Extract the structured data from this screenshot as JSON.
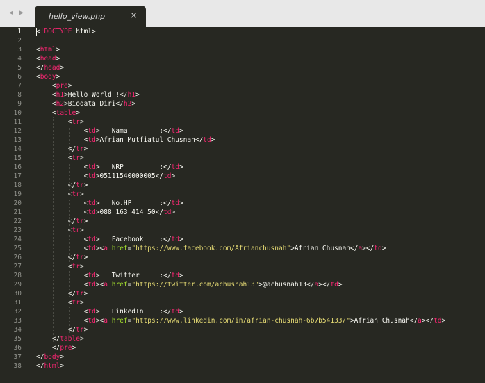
{
  "tab": {
    "title": "hello_view.php",
    "close": "×"
  },
  "nav": {
    "back": "◀",
    "forward": "▶"
  },
  "lines": [
    {
      "n": "1",
      "tokens": [
        [
          "t",
          "<"
        ],
        [
          "k",
          "!DOCTYPE"
        ],
        [
          "t",
          " html>"
        ]
      ]
    },
    {
      "n": "2",
      "tokens": []
    },
    {
      "n": "3",
      "tokens": [
        [
          "t",
          "<"
        ],
        [
          "k",
          "html"
        ],
        [
          "t",
          ">"
        ]
      ]
    },
    {
      "n": "4",
      "tokens": [
        [
          "t",
          "<"
        ],
        [
          "k",
          "head"
        ],
        [
          "t",
          ">"
        ]
      ]
    },
    {
      "n": "5",
      "tokens": [
        [
          "t",
          "</"
        ],
        [
          "k",
          "head"
        ],
        [
          "t",
          ">"
        ]
      ]
    },
    {
      "n": "6",
      "tokens": [
        [
          "t",
          "<"
        ],
        [
          "k",
          "body"
        ],
        [
          "t",
          ">"
        ]
      ]
    },
    {
      "n": "7",
      "tokens": [
        [
          "t",
          "    <"
        ],
        [
          "k",
          "pre"
        ],
        [
          "t",
          ">"
        ]
      ]
    },
    {
      "n": "8",
      "tokens": [
        [
          "t",
          "    <"
        ],
        [
          "k",
          "h1"
        ],
        [
          "t",
          ">Hello World !</"
        ],
        [
          "k",
          "h1"
        ],
        [
          "t",
          ">"
        ]
      ]
    },
    {
      "n": "9",
      "tokens": [
        [
          "t",
          "    <"
        ],
        [
          "k",
          "h2"
        ],
        [
          "t",
          ">Biodata Diri</"
        ],
        [
          "k",
          "h2"
        ],
        [
          "t",
          ">"
        ]
      ]
    },
    {
      "n": "10",
      "tokens": [
        [
          "t",
          "    <"
        ],
        [
          "k",
          "table"
        ],
        [
          "t",
          ">"
        ]
      ]
    },
    {
      "n": "11",
      "tokens": [
        [
          "t",
          "        <"
        ],
        [
          "k",
          "tr"
        ],
        [
          "t",
          ">"
        ]
      ]
    },
    {
      "n": "12",
      "tokens": [
        [
          "t",
          "            <"
        ],
        [
          "k",
          "td"
        ],
        [
          "t",
          ">   Nama        :</"
        ],
        [
          "k",
          "td"
        ],
        [
          "t",
          ">"
        ]
      ]
    },
    {
      "n": "13",
      "tokens": [
        [
          "t",
          "            <"
        ],
        [
          "k",
          "td"
        ],
        [
          "t",
          ">Afrian Mutfiatul Chusnah</"
        ],
        [
          "k",
          "td"
        ],
        [
          "t",
          ">"
        ]
      ]
    },
    {
      "n": "14",
      "tokens": [
        [
          "t",
          "        </"
        ],
        [
          "k",
          "tr"
        ],
        [
          "t",
          ">"
        ]
      ]
    },
    {
      "n": "15",
      "tokens": [
        [
          "t",
          "        <"
        ],
        [
          "k",
          "tr"
        ],
        [
          "t",
          ">"
        ]
      ]
    },
    {
      "n": "16",
      "tokens": [
        [
          "t",
          "            <"
        ],
        [
          "k",
          "td"
        ],
        [
          "t",
          ">   NRP         :</"
        ],
        [
          "k",
          "td"
        ],
        [
          "t",
          ">"
        ]
      ]
    },
    {
      "n": "17",
      "tokens": [
        [
          "t",
          "            <"
        ],
        [
          "k",
          "td"
        ],
        [
          "t",
          ">05111540000005</"
        ],
        [
          "k",
          "td"
        ],
        [
          "t",
          ">"
        ]
      ]
    },
    {
      "n": "18",
      "tokens": [
        [
          "t",
          "        </"
        ],
        [
          "k",
          "tr"
        ],
        [
          "t",
          ">"
        ]
      ]
    },
    {
      "n": "19",
      "tokens": [
        [
          "t",
          "        <"
        ],
        [
          "k",
          "tr"
        ],
        [
          "t",
          ">"
        ]
      ]
    },
    {
      "n": "20",
      "tokens": [
        [
          "t",
          "            <"
        ],
        [
          "k",
          "td"
        ],
        [
          "t",
          ">   No.HP       :</"
        ],
        [
          "k",
          "td"
        ],
        [
          "t",
          ">"
        ]
      ]
    },
    {
      "n": "21",
      "tokens": [
        [
          "t",
          "            <"
        ],
        [
          "k",
          "td"
        ],
        [
          "t",
          ">088 163 414 50</"
        ],
        [
          "k",
          "td"
        ],
        [
          "t",
          ">"
        ]
      ]
    },
    {
      "n": "22",
      "tokens": [
        [
          "t",
          "        </"
        ],
        [
          "k",
          "tr"
        ],
        [
          "t",
          ">"
        ]
      ]
    },
    {
      "n": "23",
      "tokens": [
        [
          "t",
          "        <"
        ],
        [
          "k",
          "tr"
        ],
        [
          "t",
          ">"
        ]
      ]
    },
    {
      "n": "24",
      "tokens": [
        [
          "t",
          "            <"
        ],
        [
          "k",
          "td"
        ],
        [
          "t",
          ">   Facebook    :</"
        ],
        [
          "k",
          "td"
        ],
        [
          "t",
          ">"
        ]
      ]
    },
    {
      "n": "25",
      "tokens": [
        [
          "t",
          "            <"
        ],
        [
          "k",
          "td"
        ],
        [
          "t",
          "><"
        ],
        [
          "k",
          "a"
        ],
        [
          "t",
          " "
        ],
        [
          "a",
          "href"
        ],
        [
          "t",
          "="
        ],
        [
          "s",
          "\"https://www.facebook.com/Afrianchusnah\""
        ],
        [
          "t",
          ">Afrian Chusnah</"
        ],
        [
          "k",
          "a"
        ],
        [
          "t",
          "></"
        ],
        [
          "k",
          "td"
        ],
        [
          "t",
          ">"
        ]
      ]
    },
    {
      "n": "26",
      "tokens": [
        [
          "t",
          "        </"
        ],
        [
          "k",
          "tr"
        ],
        [
          "t",
          ">"
        ]
      ]
    },
    {
      "n": "27",
      "tokens": [
        [
          "t",
          "        <"
        ],
        [
          "k",
          "tr"
        ],
        [
          "t",
          ">"
        ]
      ]
    },
    {
      "n": "28",
      "tokens": [
        [
          "t",
          "            <"
        ],
        [
          "k",
          "td"
        ],
        [
          "t",
          ">   Twitter     :</"
        ],
        [
          "k",
          "td"
        ],
        [
          "t",
          ">"
        ]
      ]
    },
    {
      "n": "29",
      "tokens": [
        [
          "t",
          "            <"
        ],
        [
          "k",
          "td"
        ],
        [
          "t",
          "><"
        ],
        [
          "k",
          "a"
        ],
        [
          "t",
          " "
        ],
        [
          "a",
          "href"
        ],
        [
          "t",
          "="
        ],
        [
          "s",
          "\"https://twitter.com/achusnah13\""
        ],
        [
          "t",
          ">@achusnah13</"
        ],
        [
          "k",
          "a"
        ],
        [
          "t",
          "></"
        ],
        [
          "k",
          "td"
        ],
        [
          "t",
          ">"
        ]
      ]
    },
    {
      "n": "30",
      "tokens": [
        [
          "t",
          "        </"
        ],
        [
          "k",
          "tr"
        ],
        [
          "t",
          ">"
        ]
      ]
    },
    {
      "n": "31",
      "tokens": [
        [
          "t",
          "        <"
        ],
        [
          "k",
          "tr"
        ],
        [
          "t",
          ">"
        ]
      ]
    },
    {
      "n": "32",
      "tokens": [
        [
          "t",
          "            <"
        ],
        [
          "k",
          "td"
        ],
        [
          "t",
          ">   LinkedIn    :</"
        ],
        [
          "k",
          "td"
        ],
        [
          "t",
          ">"
        ]
      ]
    },
    {
      "n": "33",
      "tokens": [
        [
          "t",
          "            <"
        ],
        [
          "k",
          "td"
        ],
        [
          "t",
          "><"
        ],
        [
          "k",
          "a"
        ],
        [
          "t",
          " "
        ],
        [
          "a",
          "href"
        ],
        [
          "t",
          "="
        ],
        [
          "s",
          "\"https://www.linkedin.com/in/afrian-chusnah-6b7b54133/\""
        ],
        [
          "t",
          ">Afrian Chusnah</"
        ],
        [
          "k",
          "a"
        ],
        [
          "t",
          "></"
        ],
        [
          "k",
          "td"
        ],
        [
          "t",
          ">"
        ]
      ]
    },
    {
      "n": "34",
      "tokens": [
        [
          "t",
          "        </"
        ],
        [
          "k",
          "tr"
        ],
        [
          "t",
          ">"
        ]
      ]
    },
    {
      "n": "35",
      "tokens": [
        [
          "t",
          "    </"
        ],
        [
          "k",
          "table"
        ],
        [
          "t",
          ">"
        ]
      ]
    },
    {
      "n": "36",
      "tokens": [
        [
          "t",
          "    </"
        ],
        [
          "k",
          "pre"
        ],
        [
          "t",
          ">"
        ]
      ]
    },
    {
      "n": "37",
      "tokens": [
        [
          "t",
          "</"
        ],
        [
          "k",
          "body"
        ],
        [
          "t",
          ">"
        ]
      ]
    },
    {
      "n": "38",
      "tokens": [
        [
          "t",
          "</"
        ],
        [
          "k",
          "html"
        ],
        [
          "t",
          ">"
        ]
      ]
    }
  ],
  "theme": {
    "background": "#272822",
    "tag": "#f92672",
    "attribute": "#a6e22e",
    "string": "#e6db74",
    "text": "#f8f8f2"
  }
}
